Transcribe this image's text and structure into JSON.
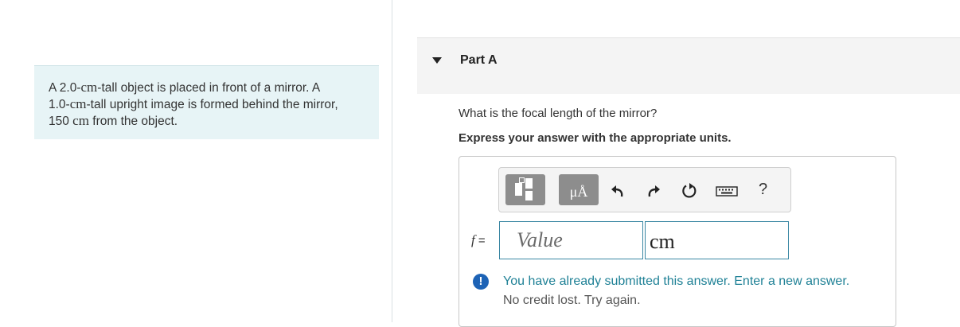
{
  "problem": {
    "line1_a": "A 2.0-",
    "unit_cm_1": "cm",
    "line1_b": "-tall object is placed in front of a mirror. A",
    "line2_a": "1.0-",
    "unit_cm_2": "cm",
    "line2_b": "-tall upright image is formed behind the mirror,",
    "line3_a": "150 ",
    "unit_cm_3": "cm",
    "line3_b": " from the object."
  },
  "part": {
    "title": "Part A"
  },
  "question": "What is the focal length of the mirror?",
  "instruction": "Express your answer with the appropriate units.",
  "toolbar": {
    "units_label": "μÅ",
    "help_label": "?",
    "icons": [
      "templates-icon",
      "units-icon",
      "undo-icon",
      "redo-icon",
      "reset-icon",
      "keyboard-icon",
      "help-icon"
    ]
  },
  "answer": {
    "variable": "f",
    "equals": " =",
    "value_placeholder": "Value",
    "unit_value": "cm"
  },
  "feedback": {
    "icon_label": "!",
    "message": "You have already submitted this answer. Enter a new answer.",
    "note": "No credit lost. Try again."
  },
  "colors": {
    "problem_bg": "#e7f4f6",
    "input_border": "#3a87a3",
    "feedback_text": "#1f8196",
    "alert_icon": "#1d63b6",
    "toolbar_button": "#8d8d8d"
  }
}
